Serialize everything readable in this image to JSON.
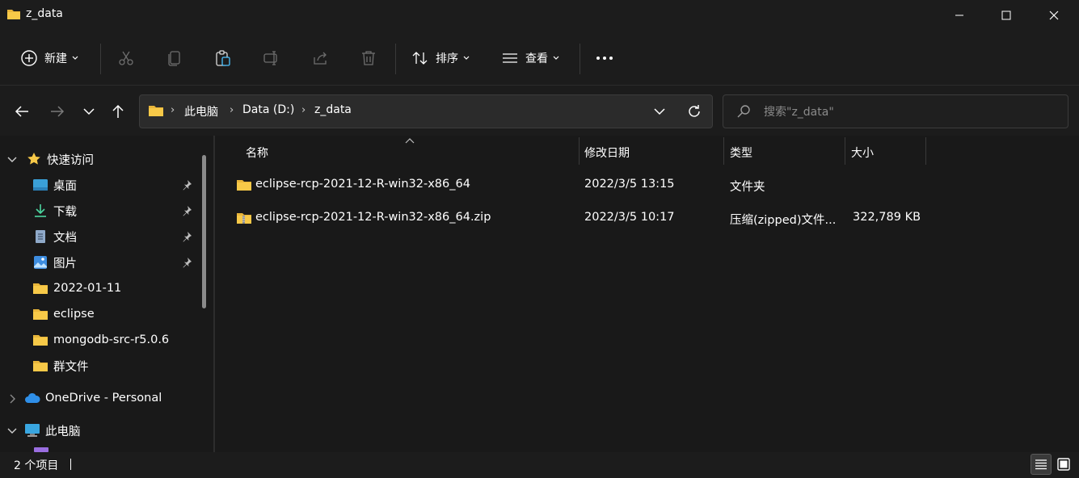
{
  "window": {
    "title": "z_data"
  },
  "toolbar": {
    "new_label": "新建",
    "sort_label": "排序",
    "view_label": "查看"
  },
  "breadcrumb": {
    "items": [
      "此电脑",
      "Data (D:)",
      "z_data"
    ]
  },
  "search": {
    "placeholder": "搜索\"z_data\""
  },
  "sidebar": {
    "quick_access": "快速访问",
    "items": [
      {
        "label": "桌面",
        "icon": "desktop-icon",
        "pinned": true
      },
      {
        "label": "下载",
        "icon": "download-icon",
        "pinned": true
      },
      {
        "label": "文档",
        "icon": "document-icon",
        "pinned": true
      },
      {
        "label": "图片",
        "icon": "pictures-icon",
        "pinned": true
      },
      {
        "label": "2022-01-11",
        "icon": "folder-icon",
        "pinned": false
      },
      {
        "label": "eclipse",
        "icon": "folder-icon",
        "pinned": false
      },
      {
        "label": "mongodb-src-r5.0.6",
        "icon": "folder-icon",
        "pinned": false
      },
      {
        "label": "群文件",
        "icon": "folder-icon",
        "pinned": false
      }
    ],
    "onedrive": "OneDrive - Personal",
    "this_pc": "此电脑"
  },
  "columns": {
    "name": "名称",
    "date": "修改日期",
    "type": "类型",
    "size": "大小"
  },
  "files": [
    {
      "name": "eclipse-rcp-2021-12-R-win32-x86_64",
      "date": "2022/3/5 13:15",
      "type": "文件夹",
      "size": "",
      "icon": "folder-icon"
    },
    {
      "name": "eclipse-rcp-2021-12-R-win32-x86_64.zip",
      "date": "2022/3/5 10:17",
      "type": "压缩(zipped)文件...",
      "size": "322,789 KB",
      "icon": "zip-folder-icon"
    }
  ],
  "status": {
    "item_count": "2 个项目"
  },
  "colors": {
    "folder": "#f7c948",
    "accent": "#4cc2ff",
    "background": "#191919"
  }
}
